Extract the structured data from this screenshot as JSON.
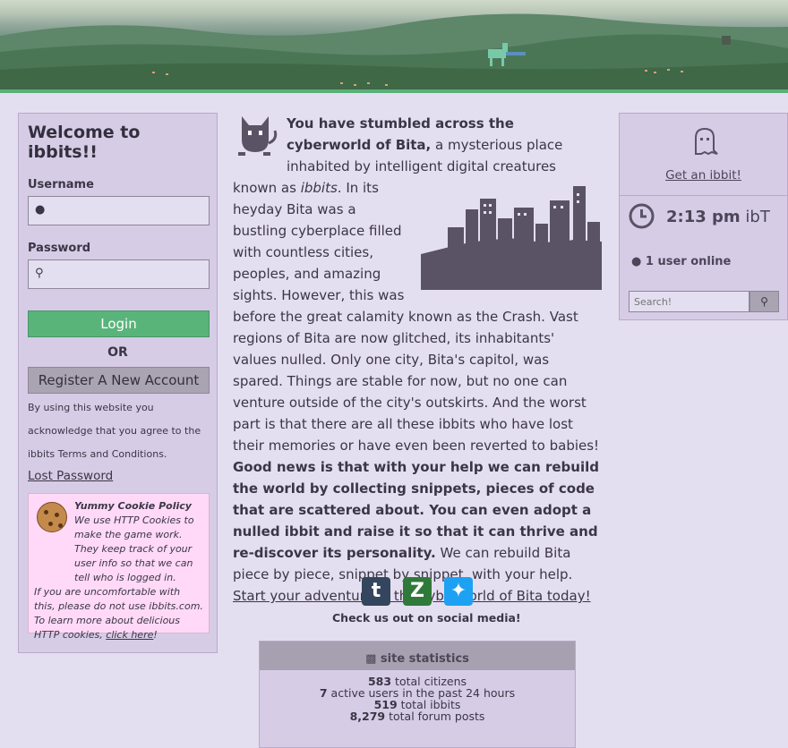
{
  "login": {
    "welcome": "Welcome to ibbits!!",
    "username_label": "Username",
    "password_label": "Password",
    "login_button": "Login",
    "or_text": "OR",
    "register_button": "Register A New Account",
    "terms_text": "By using this website you acknowledge that you agree to the ibbits Terms and Conditions.",
    "lost_password": "Lost Password"
  },
  "cookie": {
    "title": "Yummy Cookie Policy",
    "line1": "We use HTTP Cookies to make the game work. They keep track of your user info so that we can tell who is logged in.",
    "line2": "If you are uncomfortable with this, please do not use ibbits.com.",
    "line3_prefix": "To learn more about delicious HTTP cookies, ",
    "line3_link": "click here",
    "line3_suffix": "!"
  },
  "intro": {
    "bold_lead": "You have stumbled across the cyberworld of Bita,",
    "text1": " a mysterious place inhabited by intelligent digital creatures known as ",
    "ibbits_italic": "ibbits",
    "text2": ". In its heyday Bita was a bustling cyberplace filled with countless cities, peoples, and amazing sights. However, this was before the great calamity known as the Crash. Vast regions of Bita are now glitched, its inhabitants' values nulled. Only one city, Bita's capitol, was spared. Things are stable for now, but no one can venture outside of the city's outskirts. And the worst part is that there are all these ibbits who have lost their memories or have even been reverted to babies! ",
    "bold_news": "Good news is that with your help we can rebuild the world by collecting snippets, pieces of code that are scattered about. You can even adopt a nulled ibbit and raise it so that it can thrive and re-discover its personality.",
    "text3": " We can rebuild Bita piece by piece, snippet by snippet, with your help. ",
    "adventure_link": "Start your adventure in the cyberworld of Bita today!"
  },
  "social": {
    "label": "Check us out on social media!",
    "icons": [
      "tumblr-icon",
      "zazzle-icon",
      "twitter-icon"
    ]
  },
  "stats": {
    "header": "site statistics",
    "citizens_value": "583",
    "citizens_label": " total citizens",
    "active_value": "7",
    "active_label": " active users in the past 24 hours",
    "ibbits_value": "519",
    "ibbits_label": " total ibbits",
    "posts_value": "8,279",
    "posts_label": " total forum posts"
  },
  "sidebar": {
    "get_ibbit": "Get an ibbit!",
    "time": "2:13 pm",
    "time_zone": "ibT",
    "users_online": "1 user online",
    "search_placeholder": "Search!"
  },
  "colors": {
    "background": "#e4dff0",
    "panel": "#d6cce6",
    "login_green": "#59b47a",
    "cookie_pink": "#ffd9f7"
  }
}
